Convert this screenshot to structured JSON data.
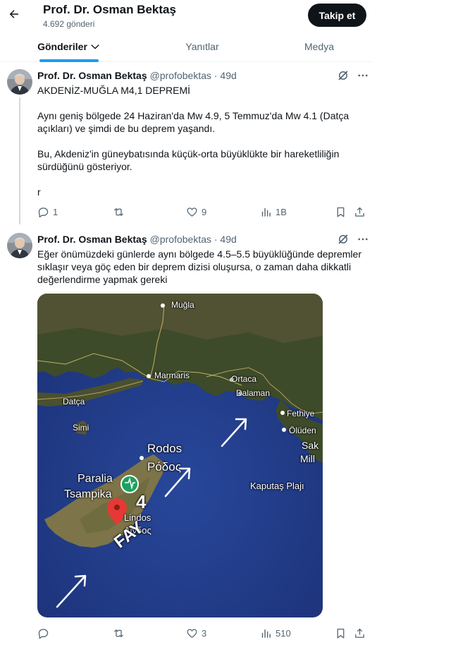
{
  "header": {
    "profile_name": "Prof. Dr. Osman Bektaş",
    "post_count": "4.692 gönderi",
    "follow_label": "Takip et"
  },
  "tabs": [
    {
      "label": "Gönderiler",
      "active": true
    },
    {
      "label": "Yanıtlar",
      "active": false
    },
    {
      "label": "Medya",
      "active": false
    }
  ],
  "posts": [
    {
      "author": "Prof. Dr. Osman Bektaş",
      "handle": "@profobektas · 49d",
      "lines": [
        "AKDENİZ-MUĞLA M4,1 DEPREMİ",
        "",
        "Aynı geniş bölgede 24 Haziran'da Mw 4.9, 5 Temmuz'da Mw 4.1 (Datça",
        "açıkları) ve şimdi de bu deprem yaşandı.",
        "",
        "Bu, Akdeniz'in güneybatısında küçük-orta büyüklükte bir hareketliliğin",
        "sürdüğünü gösteriyor.",
        "",
        "r"
      ],
      "stats": {
        "replies": "1",
        "reposts": "",
        "likes": "9",
        "views": "1B"
      }
    },
    {
      "author": "Prof. Dr. Osman Bektaş",
      "handle": "@profobektas · 49d",
      "lines": [
        "Eğer önümüzdeki günlerde aynı bölgede 4.5–5.5 büyüklüğünde depremler",
        "sıklaşır veya göç eden bir deprem dizisi oluşursa, o zaman daha dikkatli",
        "değerlendirme yapmak gereki"
      ],
      "stats": {
        "replies": "",
        "reposts": "",
        "likes": "3",
        "views": "510"
      }
    }
  ],
  "map": {
    "labels": {
      "mugla": "Muğla",
      "marmaris": "Marmaris",
      "datca": "Datça",
      "simi": "Simi",
      "ortaca": "Ortaca",
      "dalaman": "Dalaman",
      "fethiye": "Fethiye",
      "oluden": "Ölüden",
      "sak": "Sak",
      "mill": "Mill",
      "rodos": "Rodos",
      "rodos_gr": "Ρόδος",
      "paralia": "Paralia",
      "tsampika": "Tsampika",
      "lindos": "Lindos",
      "lindos_gr": "Λίνδος",
      "kaputas": "Kaputaş Plajı",
      "fay": "FAY",
      "quake_number": "4"
    },
    "colors": {
      "sea": "#233f8e",
      "land": "#3f4a2c",
      "pin": "#e53935",
      "badge": "#1aa260"
    }
  },
  "colors": {
    "accent": "#1d9bf0",
    "text": "#0f1419",
    "muted": "#536471"
  }
}
